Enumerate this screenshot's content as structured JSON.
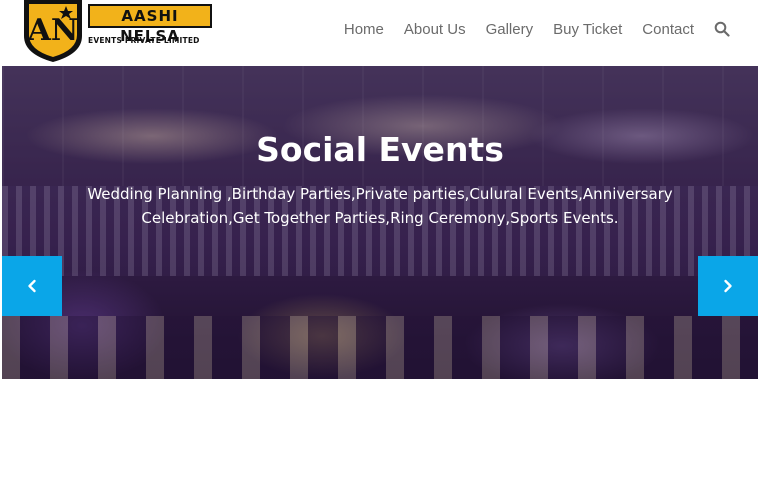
{
  "brand": {
    "name": "AASHI NELSA",
    "subtitle": "EVENTS PRIVATE LIMITED",
    "monogram": "AN",
    "colors": {
      "gold": "#f2b21a",
      "dark": "#111111"
    }
  },
  "nav": {
    "items": [
      {
        "label": "Home"
      },
      {
        "label": "About Us"
      },
      {
        "label": "Gallery"
      },
      {
        "label": "Buy Ticket"
      },
      {
        "label": "Contact"
      }
    ],
    "search_icon": "search-icon"
  },
  "hero": {
    "title": "Social Events",
    "description": "Wedding Planning ,Birthday Parties,Private parties,Culural Events,Anniversary Celebration,Get Together Parties,Ring Ceremony,Sports Events.",
    "prev_icon": "chevron-left-icon",
    "next_icon": "chevron-right-icon",
    "accent": "#0aa6e8"
  }
}
